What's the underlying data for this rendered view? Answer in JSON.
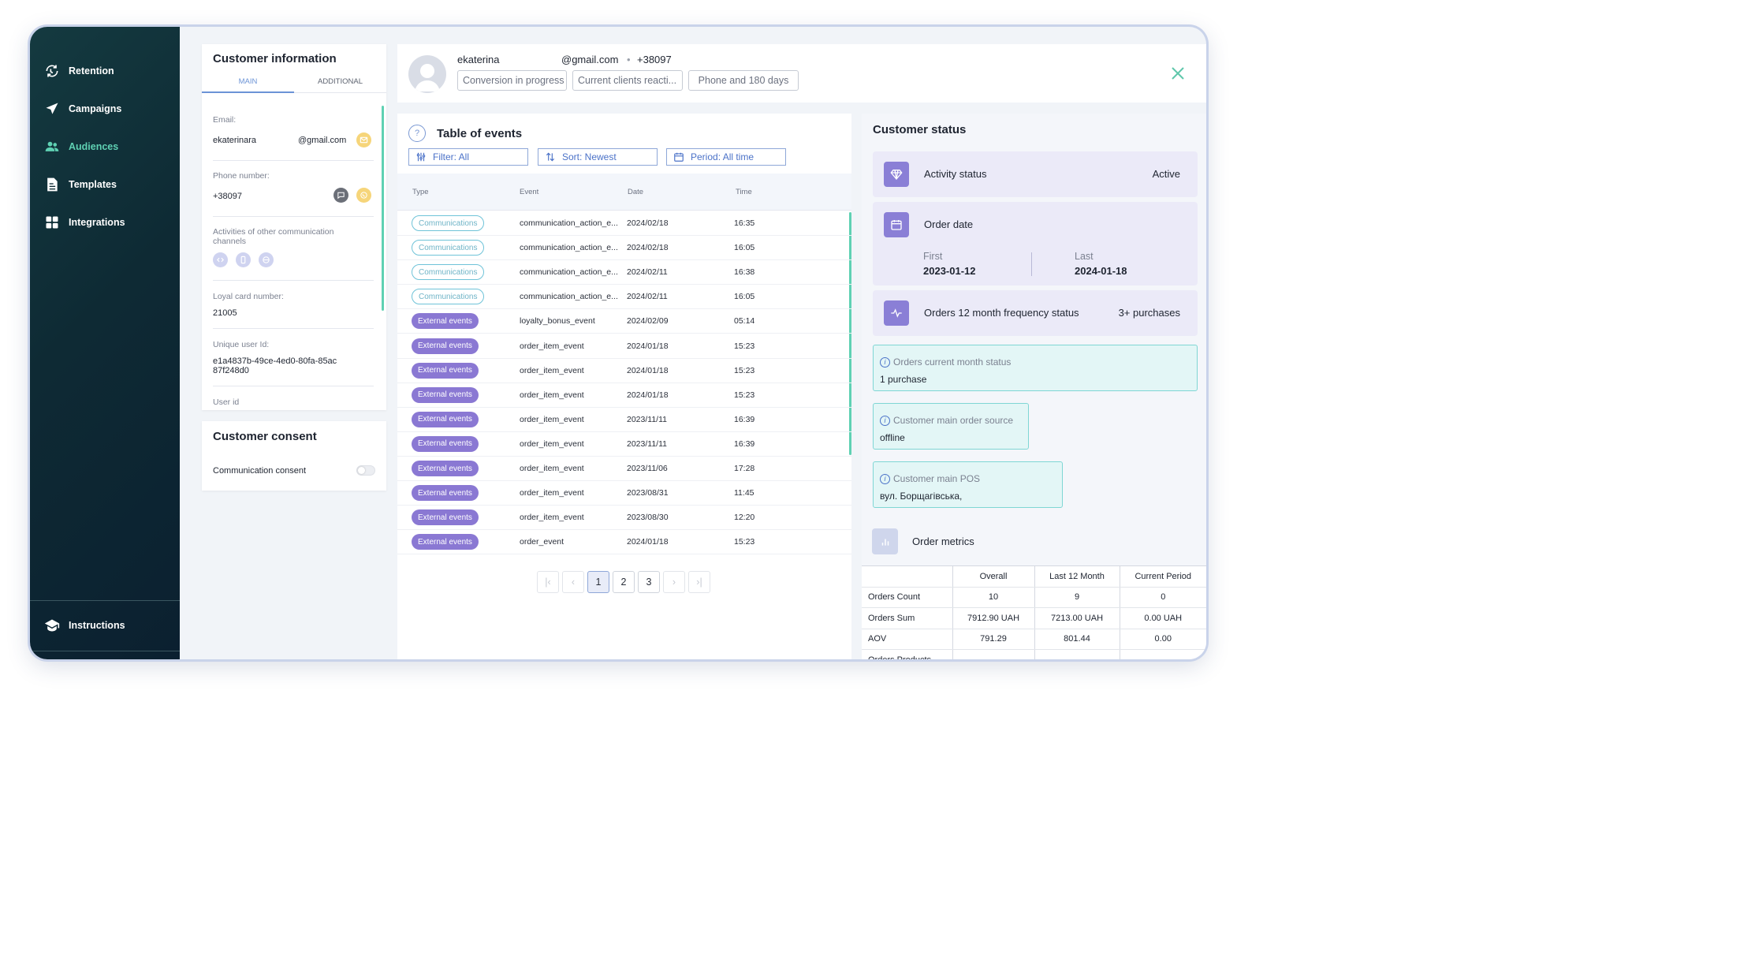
{
  "sidebar": {
    "items": [
      {
        "label": "Retention",
        "icon": "retention-icon"
      },
      {
        "label": "Campaigns",
        "icon": "send-icon"
      },
      {
        "label": "Audiences",
        "icon": "users-icon"
      },
      {
        "label": "Templates",
        "icon": "document-icon"
      },
      {
        "label": "Integrations",
        "icon": "grid-icon"
      }
    ],
    "active": "Audiences",
    "footer": {
      "label": "Instructions",
      "icon": "graduation-cap-icon"
    }
  },
  "customer_info": {
    "title": "Customer information",
    "tabs": [
      "MAIN",
      "ADDITIONAL"
    ],
    "active_tab": "MAIN",
    "email_label": "Email:",
    "email_user": "ekaterinara",
    "email_domain": "@gmail.com",
    "phone_label": "Phone number:",
    "phone_value": "+38097",
    "activities_label": "Activities of other communication channels",
    "loyal_label": "Loyal card number:",
    "loyal_value": "21005",
    "uid_label": "Unique user Id:",
    "uid_value": "e1a4837b-49ce-4ed0-80fa-85ac87f248d0",
    "userid_label": "User id"
  },
  "consent": {
    "title": "Customer consent",
    "item_label": "Communication consent",
    "enabled": false
  },
  "profile": {
    "name": "ekaterina",
    "email": "@gmail.com",
    "separator": "•",
    "phone": "+38097",
    "tags": [
      "Conversion in progress",
      "Current clients reacti...",
      "Phone and 180 days"
    ]
  },
  "events": {
    "title": "Table of events",
    "filter": "Filter: All",
    "sort": "Sort: Newest",
    "period": "Period: All time",
    "columns": [
      "Type",
      "Event",
      "Date",
      "Time"
    ],
    "rows": [
      {
        "type": "Communications",
        "style": "outline",
        "event": "communication_action_e...",
        "date": "2024/02/18",
        "time": "16:35"
      },
      {
        "type": "Communications",
        "style": "outline",
        "event": "communication_action_e...",
        "date": "2024/02/18",
        "time": "16:05"
      },
      {
        "type": "Communications",
        "style": "outline",
        "event": "communication_action_e...",
        "date": "2024/02/11",
        "time": "16:38"
      },
      {
        "type": "Communications",
        "style": "outline",
        "event": "communication_action_e...",
        "date": "2024/02/11",
        "time": "16:05"
      },
      {
        "type": "External events",
        "style": "filled",
        "event": "loyalty_bonus_event",
        "date": "2024/02/09",
        "time": "05:14"
      },
      {
        "type": "External events",
        "style": "filled",
        "event": "order_item_event",
        "date": "2024/01/18",
        "time": "15:23"
      },
      {
        "type": "External events",
        "style": "filled",
        "event": "order_item_event",
        "date": "2024/01/18",
        "time": "15:23"
      },
      {
        "type": "External events",
        "style": "filled",
        "event": "order_item_event",
        "date": "2024/01/18",
        "time": "15:23"
      },
      {
        "type": "External events",
        "style": "filled",
        "event": "order_item_event",
        "date": "2023/11/11",
        "time": "16:39"
      },
      {
        "type": "External events",
        "style": "filled",
        "event": "order_item_event",
        "date": "2023/11/11",
        "time": "16:39"
      },
      {
        "type": "External events",
        "style": "filled",
        "event": "order_item_event",
        "date": "2023/11/06",
        "time": "17:28"
      },
      {
        "type": "External events",
        "style": "filled",
        "event": "order_item_event",
        "date": "2023/08/31",
        "time": "11:45"
      },
      {
        "type": "External events",
        "style": "filled",
        "event": "order_item_event",
        "date": "2023/08/30",
        "time": "12:20"
      },
      {
        "type": "External events",
        "style": "filled",
        "event": "order_event",
        "date": "2024/01/18",
        "time": "15:23"
      }
    ],
    "pagination": {
      "pages": [
        "1",
        "2",
        "3"
      ],
      "current": "1",
      "first": "|‹",
      "prev": "‹",
      "next": "›",
      "last": "›|"
    }
  },
  "status": {
    "title": "Customer status",
    "activity": {
      "label": "Activity status",
      "value": "Active"
    },
    "order_date": {
      "label": "Order date",
      "first_label": "First",
      "first_value": "2023-01-12",
      "last_label": "Last",
      "last_value": "2024-01-18"
    },
    "frequency": {
      "label": "Orders 12 month frequency status",
      "value": "3+ purchases"
    },
    "current_month": {
      "label": "Orders current month status",
      "value": "1 purchase"
    },
    "order_source": {
      "label": "Customer main order source",
      "value": "offline"
    },
    "main_pos": {
      "label": "Customer main POS",
      "value": "вул. Борщагівська,"
    },
    "metrics_title": "Order metrics",
    "metrics_columns": [
      "",
      "Overall",
      "Last 12 Month",
      "Current Period"
    ],
    "metrics_rows": [
      {
        "name": "Orders Count",
        "overall": "10",
        "last12": "9",
        "current": "0"
      },
      {
        "name": "Orders Sum",
        "overall": "7912.90 UAH",
        "last12": "7213.00 UAH",
        "current": "0.00 UAH"
      },
      {
        "name": "AOV",
        "overall": "791.29",
        "last12": "801.44",
        "current": "0.00"
      },
      {
        "name": "Orders Products",
        "overall": "",
        "last12": "",
        "current": ""
      }
    ]
  },
  "colors": {
    "sidebar_bg": "#0e2a34",
    "accent_teal": "#5fd1b3",
    "accent_purple": "#8a78d3",
    "link_blue": "#4b72c8"
  }
}
